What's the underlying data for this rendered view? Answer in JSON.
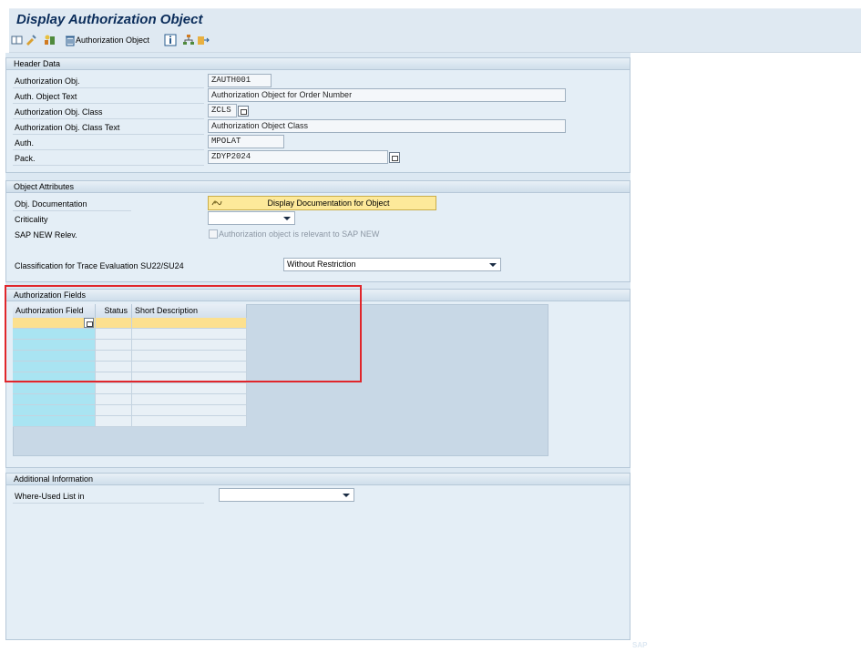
{
  "title": "Display Authorization Object",
  "toolbar": {
    "icons": [
      "display-change-icon",
      "other-object-icon",
      "where-used-icon",
      "trash-icon",
      "info-icon",
      "hierarchy-icon",
      "export-icon"
    ],
    "object_button_label": "Authorization Object"
  },
  "header_data": {
    "title": "Header Data",
    "auth_obj_label": "Authorization Obj.",
    "auth_obj_value": "ZAUTH001",
    "auth_obj_text_label": "Auth. Object Text",
    "auth_obj_text_value": "Authorization Object for Order Number",
    "auth_obj_class_label": "Authorization Obj. Class",
    "auth_obj_class_value": "ZCLS",
    "auth_obj_class_text_label": "Authorization Obj. Class Text",
    "auth_obj_class_text_value": "Authorization Object Class",
    "auth_label": "Auth.",
    "auth_value": "MPOLAT",
    "pack_label": "Pack.",
    "pack_value": "ZDYP2024"
  },
  "object_attributes": {
    "title": "Object Attributes",
    "obj_doc_label": "Obj. Documentation",
    "obj_doc_button": "Display Documentation for Object",
    "criticality_label": "Criticality",
    "criticality_value": "",
    "sap_new_label": "SAP NEW Relev.",
    "sap_new_checkbox_label": "Authorization object is relevant to SAP NEW",
    "classification_label": "Classification for Trace Evaluation SU22/SU24",
    "classification_value": "Without Restriction"
  },
  "authorization_fields": {
    "title": "Authorization Fields",
    "columns": [
      "Authorization Field",
      "Status",
      "Short Description"
    ]
  },
  "additional_info": {
    "title": "Additional Information",
    "where_used_label": "Where-Used List in",
    "where_used_value": ""
  },
  "footer_logo": "SAP",
  "colors": {
    "highlight_box": "#e0262b",
    "doc_button": "#fde99a",
    "field_column": "#a9e4f2"
  }
}
